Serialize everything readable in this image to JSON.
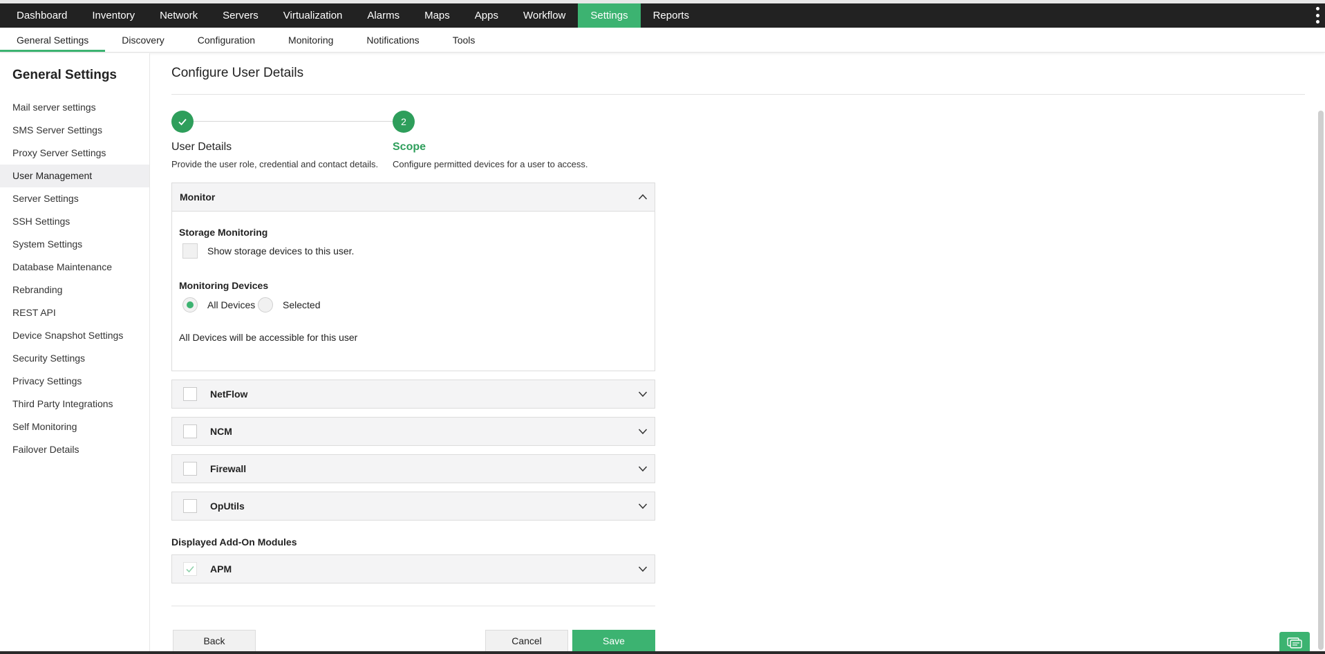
{
  "topnav": {
    "tabs": [
      {
        "label": "Dashboard"
      },
      {
        "label": "Inventory"
      },
      {
        "label": "Network"
      },
      {
        "label": "Servers"
      },
      {
        "label": "Virtualization"
      },
      {
        "label": "Alarms"
      },
      {
        "label": "Maps"
      },
      {
        "label": "Apps"
      },
      {
        "label": "Workflow"
      },
      {
        "label": "Settings"
      },
      {
        "label": "Reports"
      }
    ],
    "active": "Settings"
  },
  "subnav": {
    "tabs": [
      {
        "label": "General Settings"
      },
      {
        "label": "Discovery"
      },
      {
        "label": "Configuration"
      },
      {
        "label": "Monitoring"
      },
      {
        "label": "Notifications"
      },
      {
        "label": "Tools"
      }
    ],
    "active": "General Settings"
  },
  "sidebar": {
    "title": "General Settings",
    "items": [
      {
        "label": "Mail server settings"
      },
      {
        "label": "SMS Server Settings"
      },
      {
        "label": "Proxy Server Settings"
      },
      {
        "label": "User Management"
      },
      {
        "label": "Server Settings"
      },
      {
        "label": "SSH Settings"
      },
      {
        "label": "System Settings"
      },
      {
        "label": "Database Maintenance"
      },
      {
        "label": "Rebranding"
      },
      {
        "label": "REST API"
      },
      {
        "label": "Device Snapshot Settings"
      },
      {
        "label": "Security Settings"
      },
      {
        "label": "Privacy Settings"
      },
      {
        "label": "Third Party Integrations"
      },
      {
        "label": "Self Monitoring"
      },
      {
        "label": "Failover Details"
      }
    ],
    "active": "User Management"
  },
  "main": {
    "title": "Configure User Details",
    "steps": [
      {
        "number": "1",
        "title": "User Details",
        "description": "Provide the user role, credential and contact details.",
        "state": "done"
      },
      {
        "number": "2",
        "title": "Scope",
        "description": "Configure permitted devices for a user to access.",
        "state": "current"
      }
    ],
    "monitor": {
      "label": "Monitor",
      "storage_label": "Storage Monitoring",
      "storage_checkbox_label": "Show storage devices to this user.",
      "storage_checked": false,
      "devices_label": "Monitoring Devices",
      "radio_all": "All Devices",
      "radio_selected": "Selected",
      "selected_option": "All Devices",
      "info": "All Devices will be accessible for this user"
    },
    "modules": [
      {
        "label": "NetFlow",
        "checked": false
      },
      {
        "label": "NCM",
        "checked": false
      },
      {
        "label": "Firewall",
        "checked": false
      },
      {
        "label": "OpUtils",
        "checked": false
      }
    ],
    "addons_label": "Displayed Add-On Modules",
    "addons": [
      {
        "label": "APM",
        "checked": true
      }
    ],
    "buttons": {
      "back": "Back",
      "cancel": "Cancel",
      "save": "Save"
    }
  },
  "colors": {
    "accent": "#3cb371",
    "step_green": "#2e9e5b",
    "topnav_bg": "#222222"
  },
  "icons": {
    "kebab": "kebab-menu-icon",
    "chevron_up": "chevron-up-icon",
    "chevron_down": "chevron-down-icon",
    "check": "check-icon",
    "chat": "chat-icon"
  }
}
